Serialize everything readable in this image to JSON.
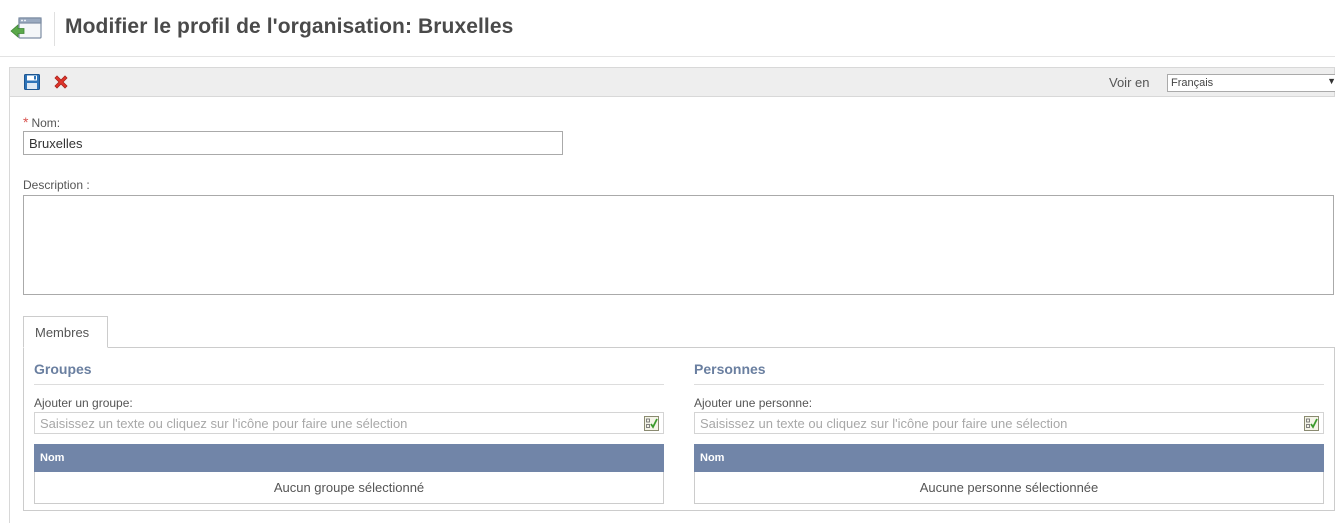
{
  "header": {
    "title": "Modifier le profil de l'organisation: Bruxelles",
    "icon": "back-window-icon"
  },
  "toolbar": {
    "save_icon": "floppy-disk-icon",
    "cancel_icon": "red-x-icon",
    "view_label": "Voir en",
    "language": "Français",
    "language_arrow": "▼"
  },
  "form": {
    "required_marker": "*",
    "name_label": "Nom:",
    "name_value": "Bruxelles",
    "description_label": "Description :",
    "description_value": ""
  },
  "tabs": [
    {
      "label": "Membres",
      "active": true
    }
  ],
  "members": {
    "groups": {
      "title": "Groupes",
      "add_label": "Ajouter un groupe:",
      "placeholder": "Saisissez un texte ou cliquez sur l'icône pour faire une sélection",
      "column_header": "Nom",
      "empty_text": "Aucun groupe sélectionné"
    },
    "persons": {
      "title": "Personnes",
      "add_label": "Ajouter une personne:",
      "placeholder": "Saisissez un texte ou cliquez sur l'icône pour faire une sélection",
      "column_header": "Nom",
      "empty_text": "Aucune personne sélectionnée"
    }
  },
  "colors": {
    "accent_title": "#6a7fa0",
    "grid_header": "#7185a8",
    "required": "#d9534f"
  }
}
